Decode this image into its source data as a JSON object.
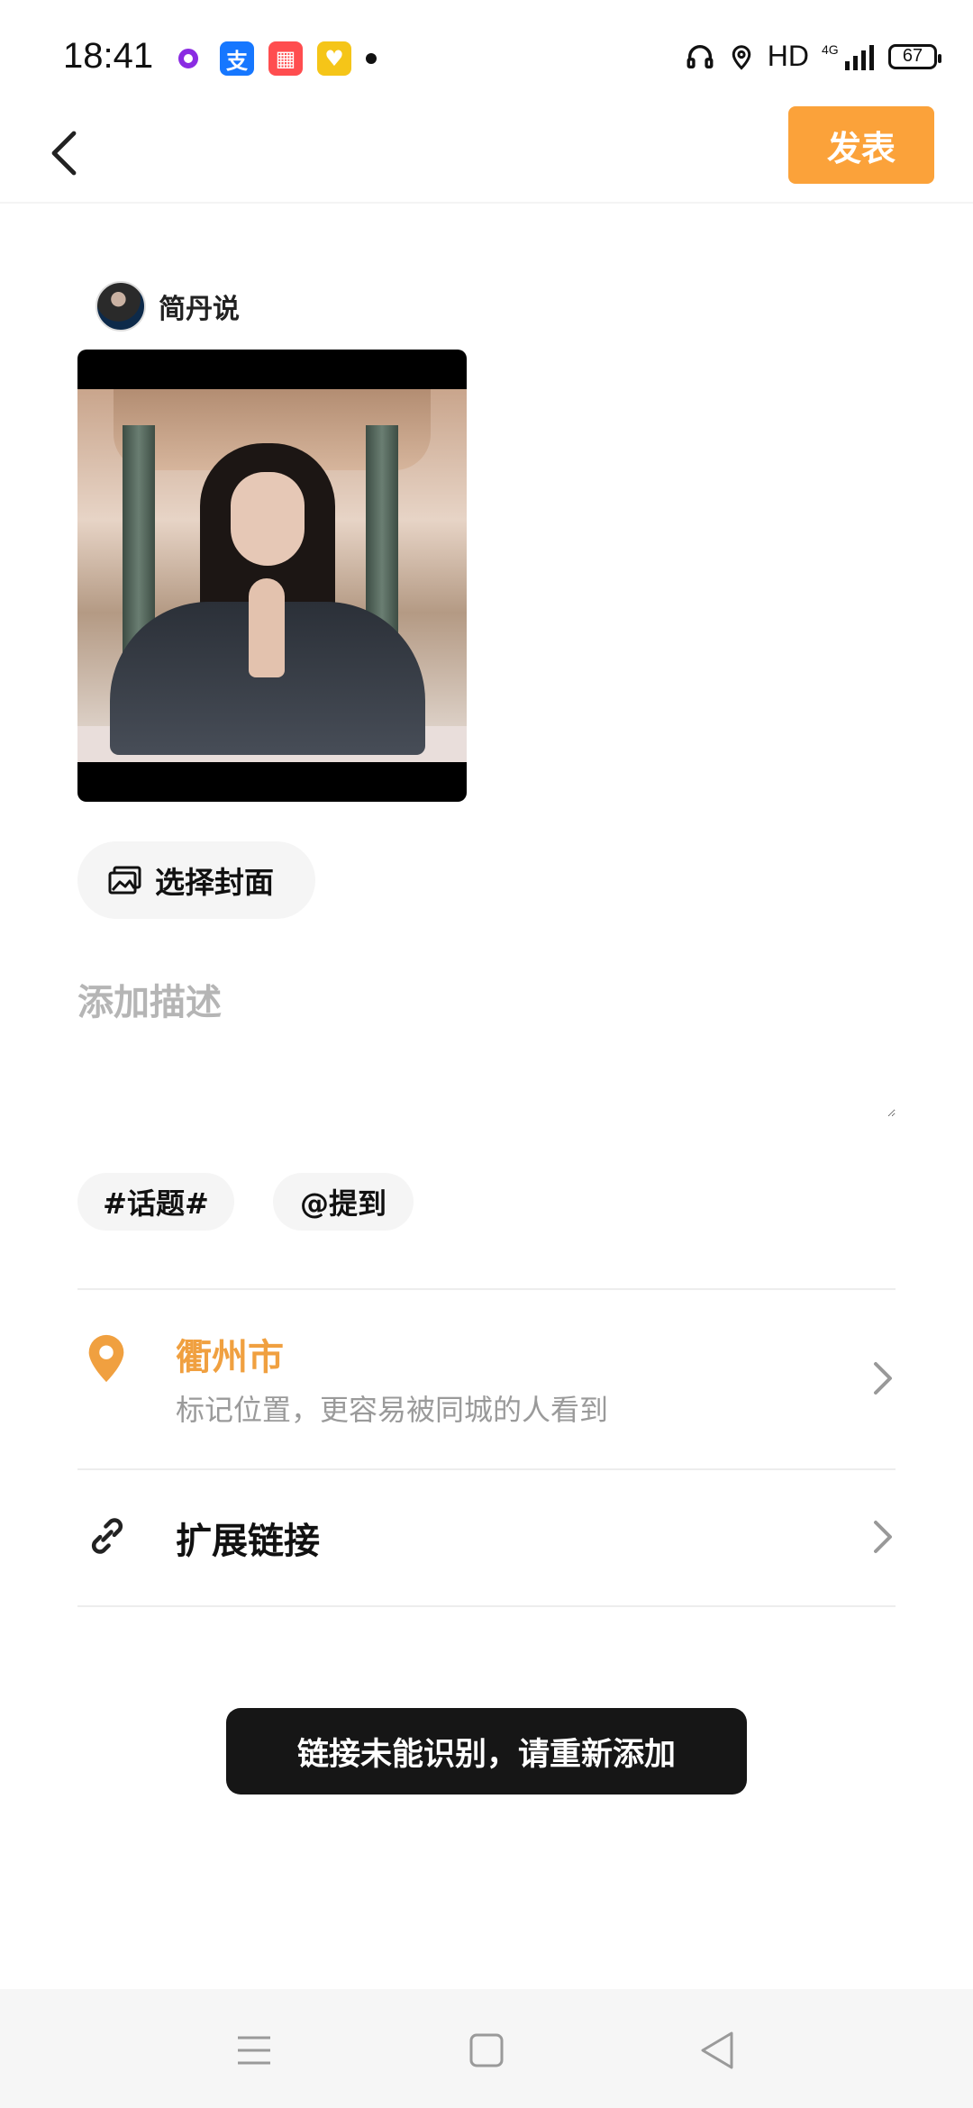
{
  "status_bar": {
    "time": "18:41",
    "network_label": "HD",
    "network_type": "4G",
    "battery": "67",
    "notification_icons": [
      "purple-ring-icon",
      "alipay-icon",
      "game-app-icon",
      "yellow-app-icon",
      "more-dot-icon"
    ],
    "system_icons": [
      "headset-icon",
      "location-pin-icon",
      "signal-icon",
      "battery-icon"
    ]
  },
  "header": {
    "back_icon": "back-arrow-icon",
    "publish_label": "发表",
    "accent_color": "#fba23a"
  },
  "author": {
    "name": "简丹说"
  },
  "cover": {
    "button_label": "选择封面",
    "icon": "image-icon"
  },
  "description": {
    "placeholder": "添加描述",
    "value": ""
  },
  "tags": {
    "topic_label": "#话题#",
    "mention_label": "@提到"
  },
  "location": {
    "icon": "location-pin-icon",
    "city": "衢州市",
    "hint": "标记位置，更容易被同城的人看到",
    "color": "#f0a040"
  },
  "extension_link": {
    "icon": "link-icon",
    "label": "扩展链接"
  },
  "toast": {
    "message": "链接未能识别，请重新添加"
  },
  "system_nav": {
    "buttons": [
      "menu-icon",
      "home-square-icon",
      "back-triangle-icon"
    ]
  }
}
